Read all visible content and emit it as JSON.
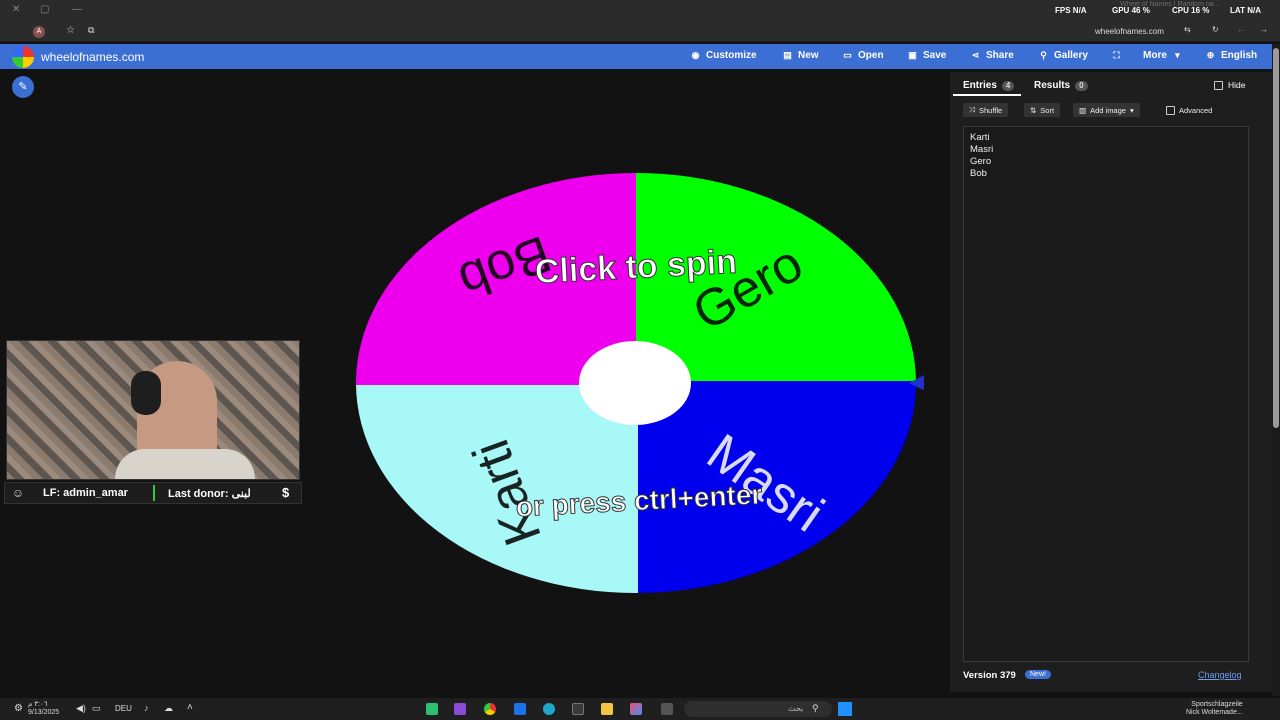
{
  "titlebar": {
    "fps_label": "FPS",
    "fps_value": "N/A",
    "gpu_label": "GPU",
    "gpu_value": "46 %",
    "cpu_label": "CPU",
    "cpu_value": "16 %",
    "lat_label": "LAT",
    "lat_value": "N/A",
    "tab_title": "Wheel of Names | Random na..."
  },
  "addressbar": {
    "url": "wheelofnames.com"
  },
  "header": {
    "brand": "wheelofnames.com",
    "nav": [
      {
        "label": "Customize",
        "icon": "palette-icon"
      },
      {
        "label": "New",
        "icon": "file-icon"
      },
      {
        "label": "Open",
        "icon": "folder-icon"
      },
      {
        "label": "Save",
        "icon": "save-icon"
      },
      {
        "label": "Share",
        "icon": "share-icon"
      },
      {
        "label": "Gallery",
        "icon": "search-icon"
      },
      {
        "label": "More",
        "icon": "chevron-down-icon"
      },
      {
        "label": "English",
        "icon": "globe-icon"
      }
    ]
  },
  "wheel": {
    "center_text": "Click to spin",
    "sub_text": "or press ctrl+enter",
    "segments": [
      {
        "name": "Gero",
        "color": "#00ff00"
      },
      {
        "name": "Masri",
        "color": "#0000ee"
      },
      {
        "name": "Karti",
        "color": "#a8f8f8"
      },
      {
        "name": "Bob",
        "color": "#ee00ee"
      }
    ],
    "pointer_color": "#2233cc"
  },
  "stream": {
    "lf_text": "LF: admin_amar",
    "donor_text": "Last donor: لبنى",
    "dollar": "$"
  },
  "panel": {
    "tabs": [
      {
        "label": "Entries",
        "count": "4"
      },
      {
        "label": "Results",
        "count": "0"
      }
    ],
    "hide_label": "Hide",
    "buttons": {
      "shuffle": "Shuffle",
      "sort": "Sort",
      "add_image": "Add image",
      "advanced": "Advanced"
    },
    "entries": [
      "Karti",
      "Masri",
      "Gero",
      "Bob"
    ],
    "version": "Version 379",
    "new_badge": "New!",
    "changelog": "Changelog"
  },
  "taskbar": {
    "time": "٣:٠٦ م",
    "date": "9/13/2025",
    "lang": "DEU",
    "search_placeholder": "بحث",
    "news_title": "Sportschlagzeile",
    "news_sub": "Nick Woltemade..."
  }
}
